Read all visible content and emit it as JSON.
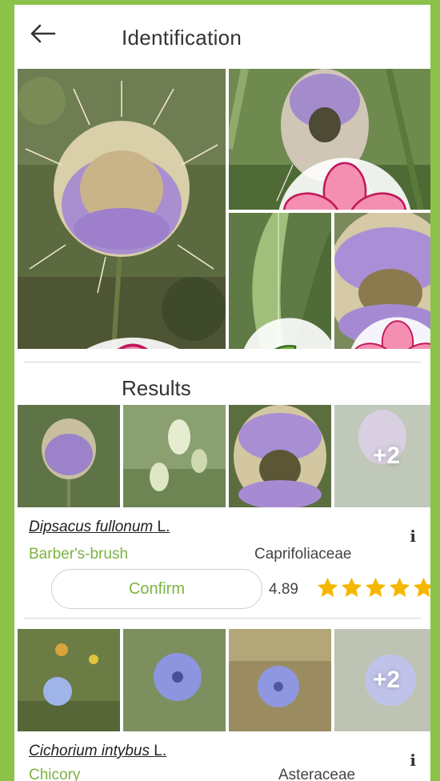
{
  "header": {
    "title": "Identification",
    "back_icon": "arrow-left-icon"
  },
  "query_photos": [
    {
      "organ": "flower",
      "badge_icon": "flower-icon"
    },
    {
      "organ": "flower",
      "badge_icon": "flower-icon"
    },
    {
      "organ": "leaf",
      "badge_icon": "leaf-icon"
    },
    {
      "organ": "flower",
      "badge_icon": "flower-icon"
    }
  ],
  "results": {
    "title": "Results",
    "items": [
      {
        "scientific_name": "Dipsacus fullonum",
        "author": "L.",
        "common_name": "Barber's-brush",
        "family": "Caprifoliaceae",
        "more_count": "+2",
        "confirm_label": "Confirm",
        "score": "4.89",
        "stars": 5,
        "info_label": "i"
      },
      {
        "scientific_name": "Cichorium intybus",
        "author": "L.",
        "common_name": "Chicory",
        "family": "Asteraceae",
        "more_count": "+2",
        "info_label": "i"
      }
    ]
  },
  "colors": {
    "accent_green": "#7cb342",
    "frame_green": "#8bc34a",
    "star_gold": "#f5b800",
    "badge_pink": "#f48fb1"
  }
}
